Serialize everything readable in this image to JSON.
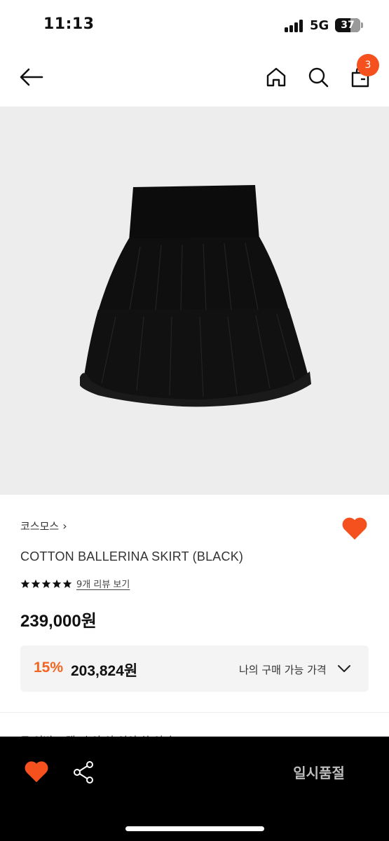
{
  "status_bar": {
    "time": "11:13",
    "network": "5G",
    "battery": "37"
  },
  "header": {
    "back_icon": "arrow-left-icon",
    "home_icon": "home-icon",
    "search_icon": "search-icon",
    "cart_icon": "shopping-bag-icon",
    "cart_count": "3"
  },
  "product": {
    "image_subject": "black tiered ballerina mini skirt",
    "brand": "코스모스",
    "name": "COTTON BALLERINA SKIRT (BLACK)",
    "rating_stars": 5,
    "review_link": "9개 리뷰 보기",
    "price": "239,000원",
    "wishlisted": true
  },
  "discount": {
    "percent": "15%",
    "price": "203,824원",
    "label": "나의 구매 가능 가격"
  },
  "peek": {
    "text": "로 이번 고객 시 아 아 인이 하 이다"
  },
  "bottom_bar": {
    "soldout_label": "일시품절"
  },
  "colors": {
    "accent": "#f4511e",
    "discount": "#f26522",
    "image_bg": "#ededed"
  }
}
